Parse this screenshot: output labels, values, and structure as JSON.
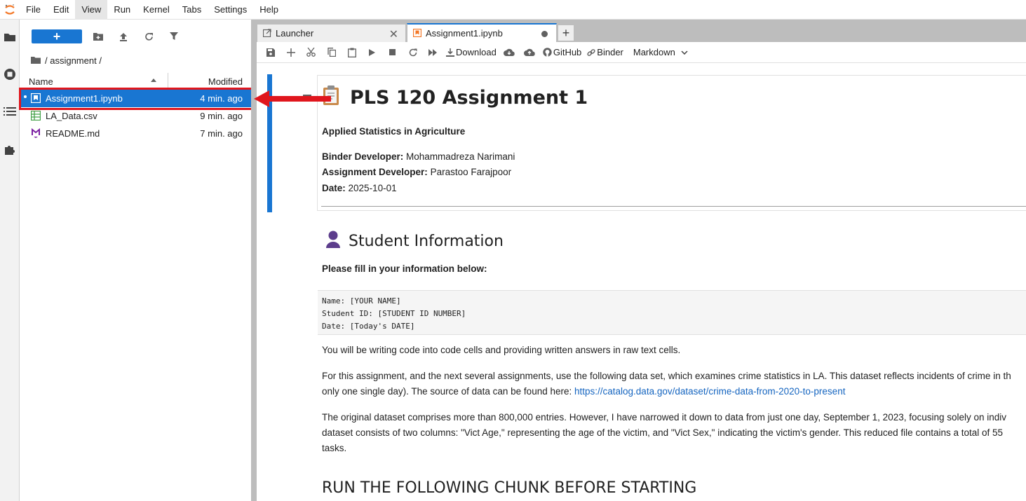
{
  "menubar": {
    "items": [
      "File",
      "Edit",
      "View",
      "Run",
      "Kernel",
      "Tabs",
      "Settings",
      "Help"
    ],
    "active": "View"
  },
  "activitybar": {
    "icons": [
      "folder-icon",
      "running-icon",
      "toc-icon",
      "extension-icon"
    ]
  },
  "filebrowser": {
    "new_label": "+",
    "breadcrumb": "/ assignment /",
    "columns": {
      "name": "Name",
      "modified": "Modified"
    },
    "files": [
      {
        "name": "Assignment1.ipynb",
        "modified": "4 min. ago",
        "icon": "notebook-icon",
        "selected": true
      },
      {
        "name": "LA_Data.csv",
        "modified": "9 min. ago",
        "icon": "spreadsheet-icon",
        "selected": false
      },
      {
        "name": "README.md",
        "modified": "7 min. ago",
        "icon": "markdown-icon",
        "selected": false
      }
    ]
  },
  "tabs": [
    {
      "label": "Launcher",
      "icon": "launcher-icon",
      "close": "✕"
    },
    {
      "label": "Assignment1.ipynb",
      "icon": "notebook-icon",
      "unsaved": true
    }
  ],
  "toolbar": {
    "download": "Download",
    "github": "GitHub",
    "binder": "Binder",
    "cell_type": "Markdown"
  },
  "notebook": {
    "title": "PLS 120 Assignment 1",
    "subtitle": "Applied Statistics in Agriculture",
    "binder_dev_label": "Binder Developer:",
    "binder_dev": "Mohammadreza Narimani",
    "assign_dev_label": "Assignment Developer:",
    "assign_dev": "Parastoo Farajpoor",
    "date_label": "Date:",
    "date": "2025-10-01",
    "student_heading": "Student Information",
    "fill_info": "Please fill in your information below:",
    "code_lines": [
      "Name: [YOUR NAME]",
      "Student ID: [STUDENT ID NUMBER]",
      "Date: [Today's DATE]"
    ],
    "para1": "You will be writing code into code cells and providing written answers in raw text cells.",
    "para2a": "For this assignment, and the next several assignments, use the following data set, which examines crime statistics in LA. This dataset reflects incidents of crime in th",
    "para2b": "only one single day). The source of data can be found here: ",
    "para2_link": "https://catalog.data.gov/dataset/crime-data-from-2020-to-present",
    "para3a": "The original dataset comprises more than 800,000 entries. However, I have narrowed it down to data from just one day, September 1, 2023, focusing solely on indiv",
    "para3b": "dataset consists of two columns: \"Vict Age,\" representing the age of the victim, and \"Vict Sex,\" indicating the victim's gender. This reduced file contains a total of 55",
    "para3c": "tasks.",
    "run_heading": "RUN THE FOLLOWING CHUNK BEFORE STARTING"
  },
  "colors": {
    "accent": "#1976d2",
    "highlight": "#e0161d",
    "link": "#1565c0"
  }
}
